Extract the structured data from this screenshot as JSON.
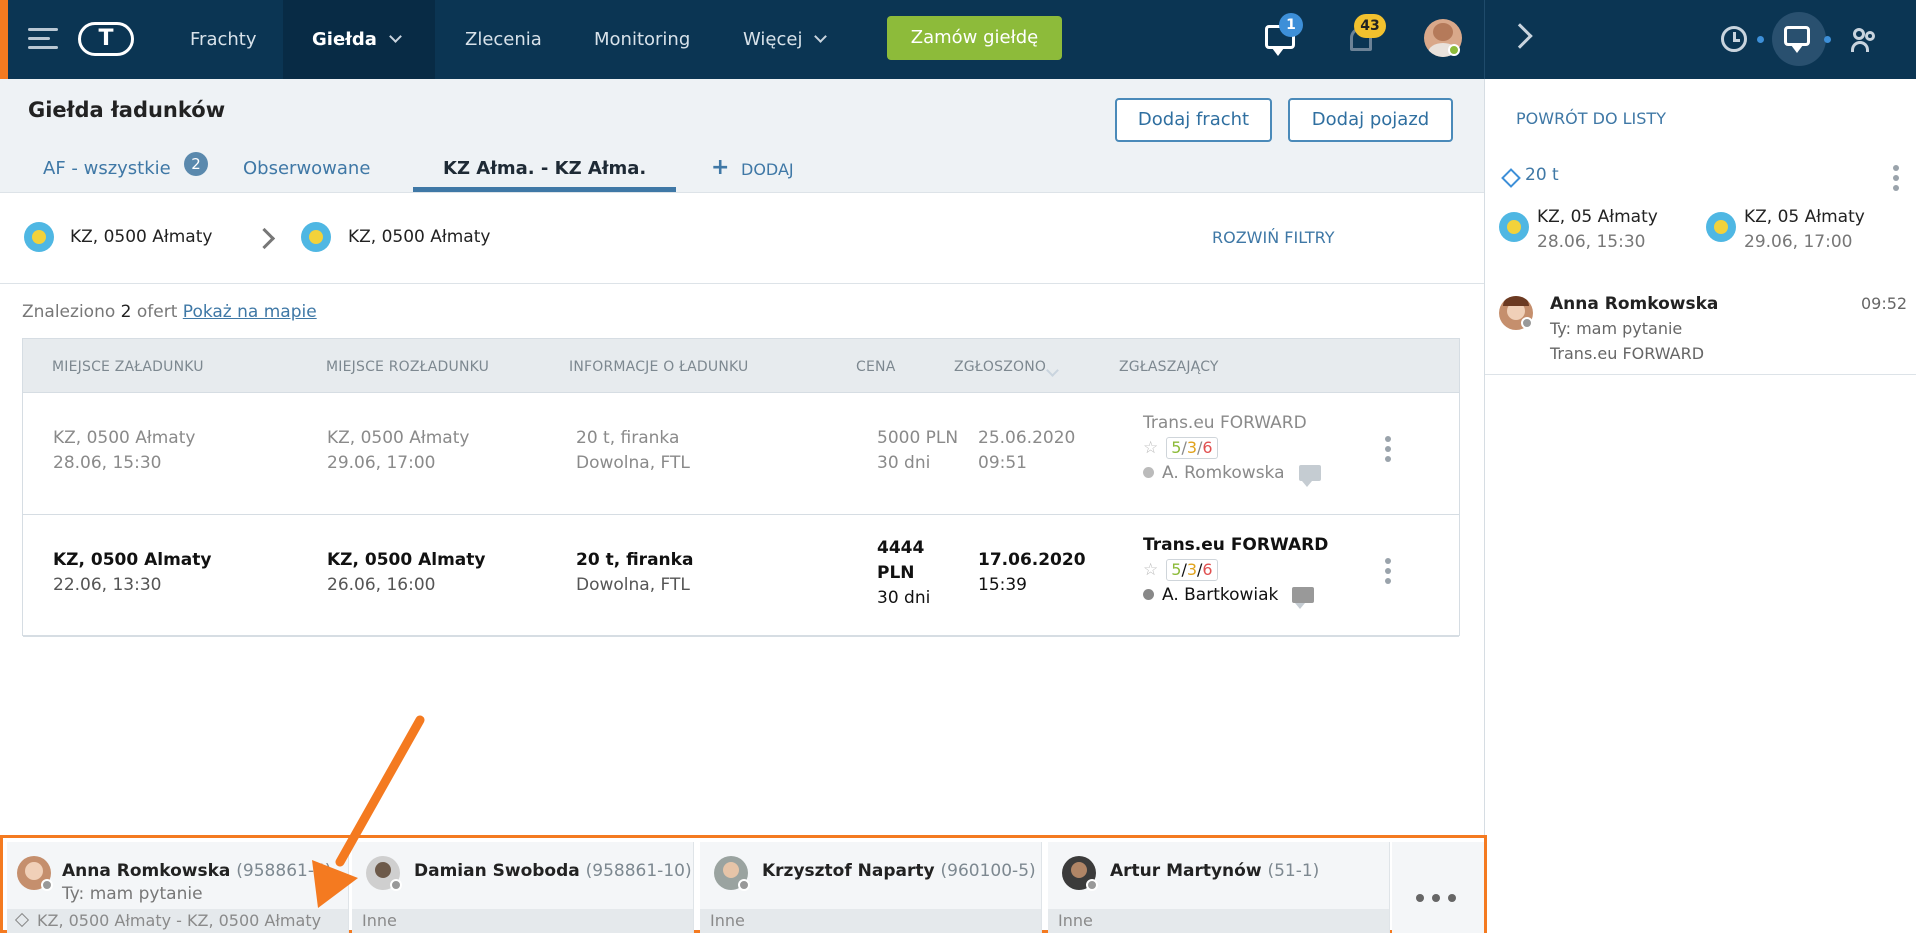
{
  "topbar": {
    "logo": "T",
    "nav": [
      "Frachty",
      "Giełda",
      "Zlecenia",
      "Monitoring",
      "Więcej"
    ],
    "order_button": "Zamów giełdę",
    "messages_count": "1",
    "notifications_count": "43",
    "colors": {
      "bar": "#0b3553",
      "accent": "#f47a20",
      "green_button": "#8dbb3a"
    }
  },
  "header": {
    "title": "Giełda ładunków",
    "add_freight": "Dodaj fracht",
    "add_vehicle": "Dodaj pojazd"
  },
  "tabs": {
    "items": [
      "AF - wszystkie",
      "Obserwowane",
      "KZ Ałma. - KZ Ałma."
    ],
    "count_badge": "2",
    "add_label": "DODAJ"
  },
  "filters": {
    "from": "KZ, 0500 Ałmaty",
    "to": "KZ, 0500 Ałmaty",
    "expand": "ROZWIŃ FILTRY"
  },
  "results": {
    "prefix": "Znaleziono",
    "count": "2",
    "suffix": "ofert",
    "map_link": "Pokaż na mapie"
  },
  "table": {
    "headers": [
      "MIEJSCE ZAŁADUNKU",
      "MIEJSCE ROZŁADUNKU",
      "INFORMACJE O ŁADUNKU",
      "CENA",
      "ZGŁOSZONO",
      "ZGŁASZAJĄCY"
    ],
    "rows": [
      {
        "load_place": "KZ, 0500 Ałmaty",
        "load_date": "28.06, 15:30",
        "unload_place": "KZ, 0500 Ałmaty",
        "unload_date": "29.06, 17:00",
        "cargo": "20 t, firanka",
        "cargo_detail": "Dowolna, FTL",
        "price": "5000 PLN",
        "terms": "30 dni",
        "reported_date": "25.06.2020",
        "reported_time": "09:51",
        "company": "Trans.eu FORWARD",
        "r1": "5",
        "r2": "3",
        "r3": "6",
        "person": "A. Romkowska"
      },
      {
        "load_place": "KZ, 0500 Almaty",
        "load_date": "22.06, 13:30",
        "unload_place": "KZ, 0500 Almaty",
        "unload_date": "26.06, 16:00",
        "cargo": "20 t, firanka",
        "cargo_detail": "Dowolna, FTL",
        "price_amount": "4444",
        "price_currency": "PLN",
        "terms": "30 dni",
        "reported_date": "17.06.2020",
        "reported_time": "15:39",
        "company": "Trans.eu FORWARD",
        "r1": "5",
        "r2": "3",
        "r3": "6",
        "person": "A. Bartkowiak"
      }
    ]
  },
  "right_panel": {
    "back": "POWRÓT DO LISTY",
    "cargo": "20 t",
    "from_place": "KZ, 05 Ałmaty",
    "from_date": "28.06, 15:30",
    "to_place": "KZ, 05 Ałmaty",
    "to_date": "29.06, 17:00",
    "contact_name": "Anna Romkowska",
    "contact_time": "09:52",
    "contact_msg": "Ty: mam pytanie",
    "contact_company": "Trans.eu FORWARD"
  },
  "chatbar": {
    "cards": [
      {
        "name": "Anna Romkowska",
        "id": "(958861-5)",
        "sub": "Ty: mam pytanie",
        "foot": "KZ, 0500 Ałmaty - KZ, 0500 Ałmaty"
      },
      {
        "name": "Damian Swoboda",
        "id": "(958861-10)",
        "sub": "",
        "foot": "Inne"
      },
      {
        "name": "Krzysztof Naparty",
        "id": "(960100-5)",
        "sub": "",
        "foot": "Inne"
      },
      {
        "name": "Artur Martynów",
        "id": "(51-1)",
        "sub": "",
        "foot": "Inne"
      }
    ]
  },
  "icons": [
    "menu-icon",
    "chevron-down-icon",
    "chat-icon",
    "bell-icon",
    "chevron-right-icon",
    "clock-icon",
    "people-icon",
    "flag-icon",
    "star-icon",
    "message-icon",
    "kebab-icon",
    "cube-icon",
    "more-icon"
  ]
}
